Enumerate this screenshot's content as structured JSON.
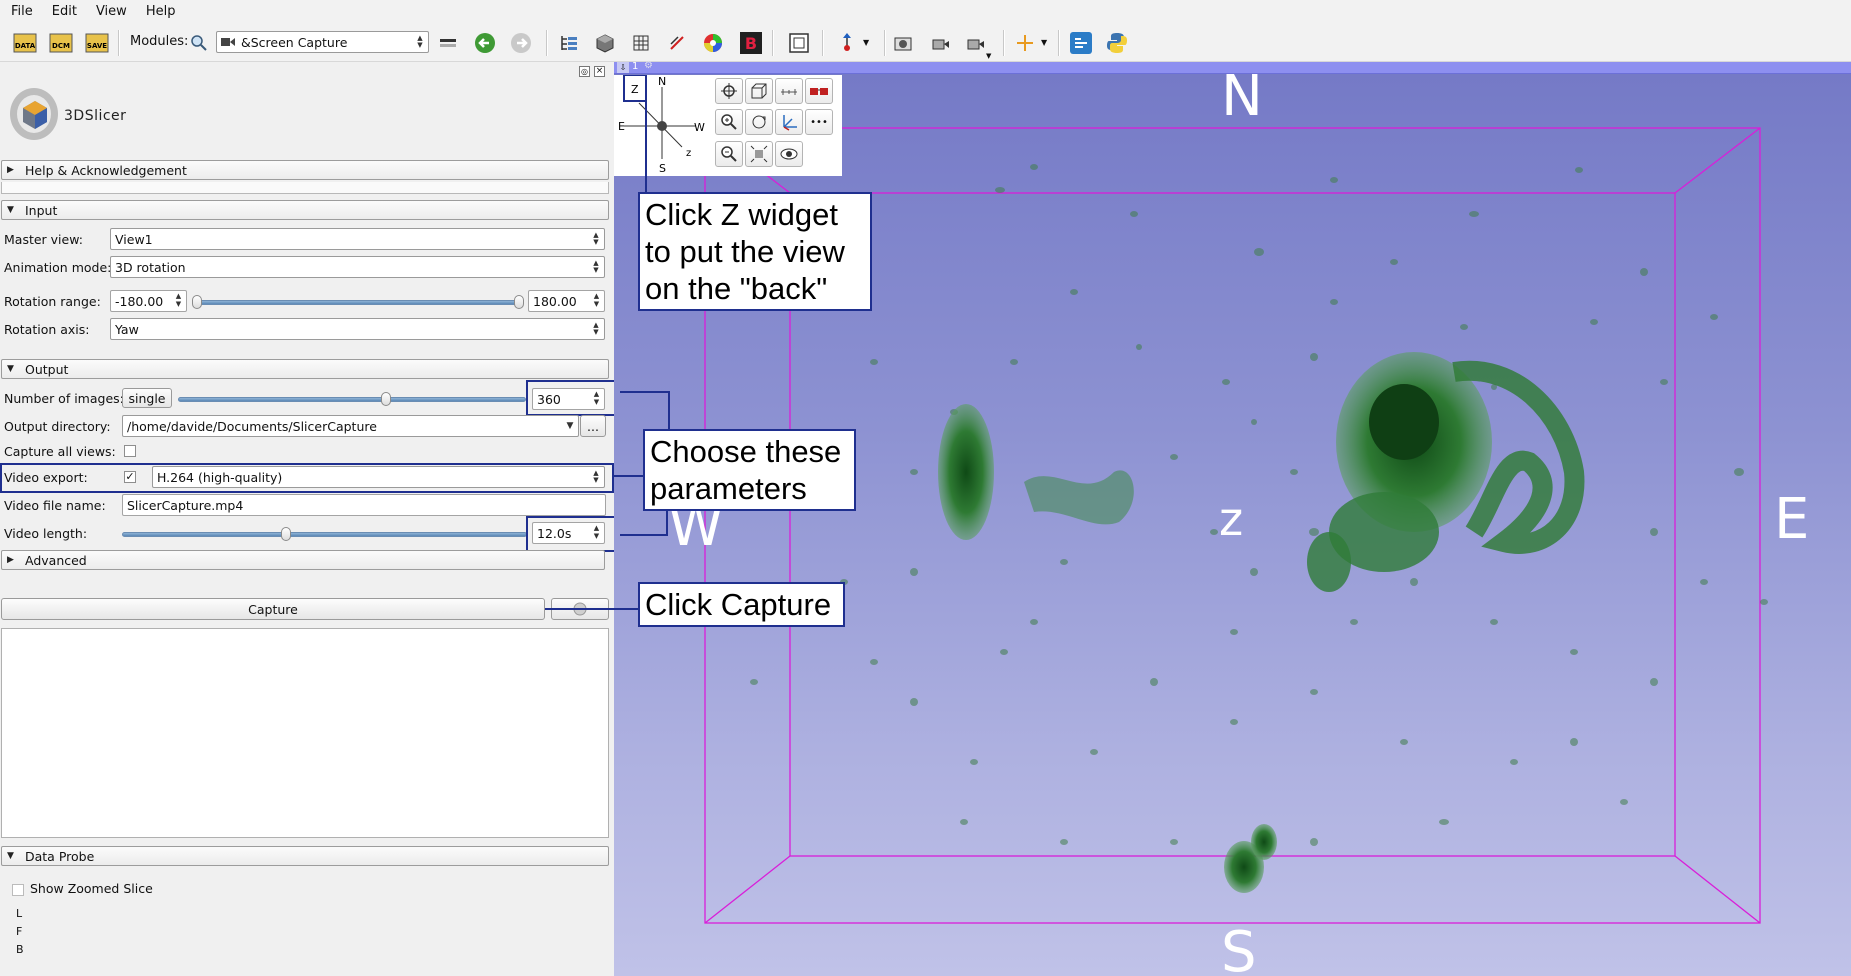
{
  "menu": [
    "File",
    "Edit",
    "View",
    "Help"
  ],
  "toolbar": {
    "data_label": "DATA",
    "dcm_label": "DCM",
    "save_label": "SAVE",
    "modules_label": "Modules:",
    "module_selected": "&Screen Capture"
  },
  "logo": {
    "text": "3DSlicer"
  },
  "sections": {
    "help": "Help & Acknowledgement",
    "input": "Input",
    "output": "Output",
    "advanced": "Advanced",
    "data_probe": "Data Probe"
  },
  "input": {
    "master_view_label": "Master view:",
    "master_view_value": "View1",
    "animation_mode_label": "Animation mode:",
    "animation_mode_value": "3D rotation",
    "rotation_range_label": "Rotation range:",
    "rotation_min": "-180.00",
    "rotation_max": "180.00",
    "rotation_axis_label": "Rotation axis:",
    "rotation_axis_value": "Yaw"
  },
  "output": {
    "num_images_label": "Number of images:",
    "single_button": "single",
    "num_images_value": "360",
    "output_dir_label": "Output directory:",
    "output_dir_value": "/home/davide/Documents/SlicerCapture",
    "browse_button": "...",
    "capture_all_label": "Capture all views:",
    "video_export_label": "Video export:",
    "video_export_checked": true,
    "video_format": "H.264 (high-quality)",
    "video_file_label": "Video file name:",
    "video_file_value": "SlicerCapture.mp4",
    "video_length_label": "Video length:",
    "video_length_value": "12.0s"
  },
  "capture_button": "Capture",
  "data_probe": {
    "show_zoomed_label": "Show Zoomed Slice",
    "lines": [
      "L",
      "F",
      "B"
    ]
  },
  "view": {
    "tab_number": "1",
    "orientation": {
      "top": "N",
      "bottom": "S",
      "left": "W",
      "right": "E",
      "center": "z"
    },
    "compass": {
      "z": "Z",
      "n": "N",
      "s": "S",
      "e": "E",
      "w": "W",
      "zlow": "z"
    }
  },
  "callouts": {
    "z_widget": "Click Z widget to put the view on the \"back\"",
    "params": "Choose these parameters",
    "capture": "Click Capture"
  },
  "colors": {
    "highlight": "#1f2f8f",
    "bbox": "#d91ed9",
    "blob": "#2e7a33",
    "view_bg_top": "#7479c6",
    "view_bg_bottom": "#c0c2e8"
  },
  "icons": [
    "search-icon",
    "screen-capture-icon",
    "back-arrow-icon",
    "forward-arrow-icon",
    "python-icon",
    "extensions-icon"
  ]
}
